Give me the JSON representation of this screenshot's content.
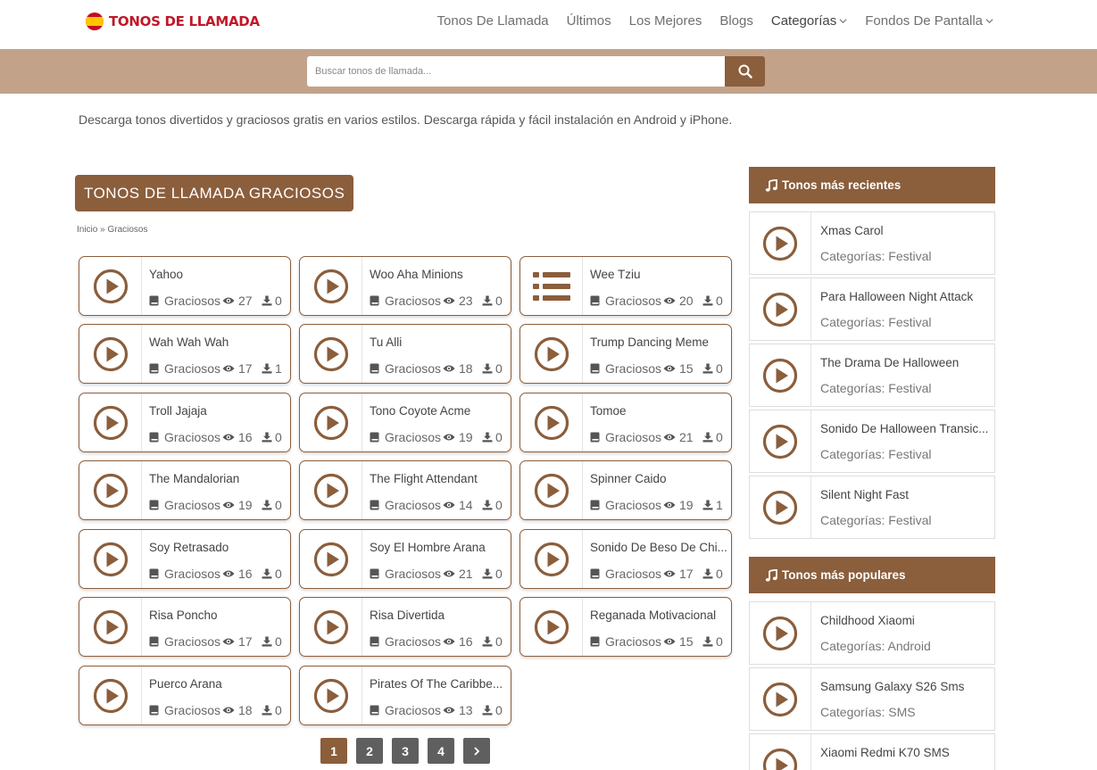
{
  "header": {
    "logo_text": "TONOS DE LLAMADA",
    "nav": [
      {
        "label": "Tonos De Llamada",
        "dropdown": false
      },
      {
        "label": "Últimos",
        "dropdown": false
      },
      {
        "label": "Los Mejores",
        "dropdown": false
      },
      {
        "label": "Blogs",
        "dropdown": false
      },
      {
        "label": "Categorías",
        "dropdown": true
      },
      {
        "label": "Fondos De Pantalla",
        "dropdown": true
      }
    ]
  },
  "search": {
    "placeholder": "Buscar tonos de llamada...",
    "button_icon": "search-icon"
  },
  "intro_text": "Descarga tonos divertidos y graciosos gratis en varios estilos. Descarga rápida y fácil instalación en Android y iPhone.",
  "main": {
    "title": "TONOS DE LLAMADA GRACIOSOS",
    "breadcrumb": "Inicio » Graciosos",
    "cards": [
      {
        "title": "Yahoo",
        "category": "Graciosos",
        "views": "27",
        "downloads": "0",
        "icon": "play-icon"
      },
      {
        "title": "Woo Aha Minions",
        "category": "Graciosos",
        "views": "23",
        "downloads": "0",
        "icon": "play-icon"
      },
      {
        "title": "Wee Tziu",
        "category": "Graciosos",
        "views": "20",
        "downloads": "0",
        "icon": "list-icon"
      },
      {
        "title": "Wah Wah Wah",
        "category": "Graciosos",
        "views": "17",
        "downloads": "1",
        "icon": "play-icon"
      },
      {
        "title": "Tu Alli",
        "category": "Graciosos",
        "views": "18",
        "downloads": "0",
        "icon": "play-icon"
      },
      {
        "title": "Trump Dancing Meme",
        "category": "Graciosos",
        "views": "15",
        "downloads": "0",
        "icon": "play-icon"
      },
      {
        "title": "Troll Jajaja",
        "category": "Graciosos",
        "views": "16",
        "downloads": "0",
        "icon": "play-icon"
      },
      {
        "title": "Tono Coyote Acme",
        "category": "Graciosos",
        "views": "19",
        "downloads": "0",
        "icon": "play-icon"
      },
      {
        "title": "Tomoe",
        "category": "Graciosos",
        "views": "21",
        "downloads": "0",
        "icon": "play-icon"
      },
      {
        "title": "The Mandalorian",
        "category": "Graciosos",
        "views": "19",
        "downloads": "0",
        "icon": "play-icon"
      },
      {
        "title": "The Flight Attendant",
        "category": "Graciosos",
        "views": "14",
        "downloads": "0",
        "icon": "play-icon"
      },
      {
        "title": "Spinner Caido",
        "category": "Graciosos",
        "views": "19",
        "downloads": "1",
        "icon": "play-icon"
      },
      {
        "title": "Soy Retrasado",
        "category": "Graciosos",
        "views": "16",
        "downloads": "0",
        "icon": "play-icon"
      },
      {
        "title": "Soy El Hombre Arana",
        "category": "Graciosos",
        "views": "21",
        "downloads": "0",
        "icon": "play-icon"
      },
      {
        "title": "Sonido De Beso De Chi...",
        "category": "Graciosos",
        "views": "17",
        "downloads": "0",
        "icon": "play-icon"
      },
      {
        "title": "Risa Poncho",
        "category": "Graciosos",
        "views": "17",
        "downloads": "0",
        "icon": "play-icon"
      },
      {
        "title": "Risa Divertida",
        "category": "Graciosos",
        "views": "16",
        "downloads": "0",
        "icon": "play-icon"
      },
      {
        "title": "Reganada Motivacional",
        "category": "Graciosos",
        "views": "15",
        "downloads": "0",
        "icon": "play-icon"
      },
      {
        "title": "Puerco Arana",
        "category": "Graciosos",
        "views": "18",
        "downloads": "0",
        "icon": "play-icon"
      },
      {
        "title": "Pirates Of The Caribbe...",
        "category": "Graciosos",
        "views": "13",
        "downloads": "0",
        "icon": "play-icon"
      }
    ]
  },
  "pagination": {
    "pages": [
      "1",
      "2",
      "3",
      "4"
    ],
    "active": "1",
    "next_icon": "chevron-right-icon"
  },
  "sidebar": {
    "recent_title": "Tonos más recientes",
    "recent": [
      {
        "title": "Xmas Carol",
        "category": "Categorías: Festival"
      },
      {
        "title": "Para Halloween Night Attack",
        "category": "Categorías: Festival"
      },
      {
        "title": "The Drama De Halloween",
        "category": "Categorías: Festival"
      },
      {
        "title": "Sonido De Halloween Transic...",
        "category": "Categorías: Festival"
      },
      {
        "title": "Silent Night Fast",
        "category": "Categorías: Festival"
      }
    ],
    "popular_title": "Tonos más populares",
    "popular": [
      {
        "title": "Childhood Xiaomi",
        "category": "Categorías: Android"
      },
      {
        "title": "Samsung Galaxy S26 Sms",
        "category": "Categorías: SMS"
      },
      {
        "title": "Xiaomi Redmi K70 SMS",
        "category": ""
      }
    ]
  },
  "colors": {
    "brand": "#8b5e3c",
    "band": "#c2a38a",
    "logo_red": "#c0182a"
  }
}
